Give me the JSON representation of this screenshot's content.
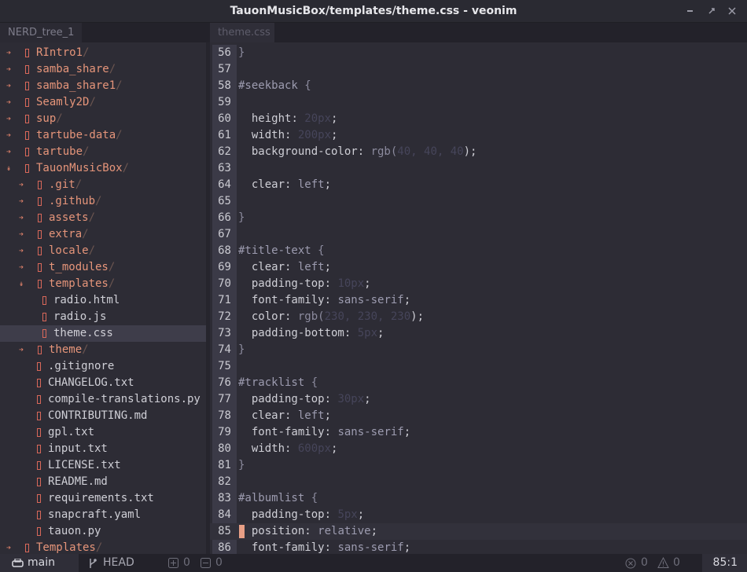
{
  "window": {
    "title": "TauonMusicBox/templates/theme.css - veonim"
  },
  "tabs": {
    "left": "NERD_tree_1",
    "right": "theme.css"
  },
  "tree": [
    {
      "indent": 0,
      "arrow": "➔",
      "name": "RIntro1",
      "slash": "/",
      "type": "dir"
    },
    {
      "indent": 0,
      "arrow": "➔",
      "name": "samba_share",
      "slash": "/",
      "type": "dir"
    },
    {
      "indent": 0,
      "arrow": "➔",
      "name": "samba_share1",
      "slash": "/",
      "type": "dir"
    },
    {
      "indent": 0,
      "arrow": "➔",
      "name": "Seamly2D",
      "slash": "/",
      "type": "dir"
    },
    {
      "indent": 0,
      "arrow": "➔",
      "name": "sup",
      "slash": "/",
      "type": "dir"
    },
    {
      "indent": 0,
      "arrow": "➔",
      "name": "tartube-data",
      "slash": "/",
      "type": "dir"
    },
    {
      "indent": 0,
      "arrow": "➔",
      "name": "tartube",
      "slash": "/",
      "type": "dir"
    },
    {
      "indent": 0,
      "arrow": "↡",
      "name": "TauonMusicBox",
      "slash": "/",
      "type": "dir"
    },
    {
      "indent": 1,
      "arrow": "➔",
      "name": ".git",
      "slash": "/",
      "type": "dir"
    },
    {
      "indent": 1,
      "arrow": "➔",
      "name": ".github",
      "slash": "/",
      "type": "dir"
    },
    {
      "indent": 1,
      "arrow": "➔",
      "name": "assets",
      "slash": "/",
      "type": "dir"
    },
    {
      "indent": 1,
      "arrow": "➔",
      "name": "extra",
      "slash": "/",
      "type": "dir"
    },
    {
      "indent": 1,
      "arrow": "➔",
      "name": "locale",
      "slash": "/",
      "type": "dir"
    },
    {
      "indent": 1,
      "arrow": "➔",
      "name": "t_modules",
      "slash": "/",
      "type": "dir"
    },
    {
      "indent": 1,
      "arrow": "↡",
      "name": "templates",
      "slash": "/",
      "type": "dir"
    },
    {
      "indent": 2,
      "arrow": "",
      "name": "radio.html",
      "slash": "",
      "type": "file"
    },
    {
      "indent": 2,
      "arrow": "",
      "name": "radio.js",
      "slash": "",
      "type": "file"
    },
    {
      "indent": 2,
      "arrow": "",
      "name": "theme.css",
      "slash": "",
      "type": "file",
      "selected": true
    },
    {
      "indent": 1,
      "arrow": "➔",
      "name": "theme",
      "slash": "/",
      "type": "dir"
    },
    {
      "indent": 1,
      "arrow": "",
      "name": ".gitignore",
      "slash": "",
      "type": "file"
    },
    {
      "indent": 1,
      "arrow": "",
      "name": "CHANGELOG.txt",
      "slash": "",
      "type": "file"
    },
    {
      "indent": 1,
      "arrow": "",
      "name": "compile-translations.py",
      "slash": "",
      "type": "file"
    },
    {
      "indent": 1,
      "arrow": "",
      "name": "CONTRIBUTING.md",
      "slash": "",
      "type": "file"
    },
    {
      "indent": 1,
      "arrow": "",
      "name": "gpl.txt",
      "slash": "",
      "type": "file"
    },
    {
      "indent": 1,
      "arrow": "",
      "name": "input.txt",
      "slash": "",
      "type": "file"
    },
    {
      "indent": 1,
      "arrow": "",
      "name": "LICENSE.txt",
      "slash": "",
      "type": "file"
    },
    {
      "indent": 1,
      "arrow": "",
      "name": "README.md",
      "slash": "",
      "type": "file"
    },
    {
      "indent": 1,
      "arrow": "",
      "name": "requirements.txt",
      "slash": "",
      "type": "file"
    },
    {
      "indent": 1,
      "arrow": "",
      "name": "snapcraft.yaml",
      "slash": "",
      "type": "file"
    },
    {
      "indent": 1,
      "arrow": "",
      "name": "tauon.py",
      "slash": "",
      "type": "file"
    },
    {
      "indent": 0,
      "arrow": "➔",
      "name": "Templates",
      "slash": "/",
      "type": "dir"
    }
  ],
  "code": [
    {
      "n": "56",
      "tokens": [
        [
          "}",
          "brace"
        ]
      ]
    },
    {
      "n": "57",
      "tokens": []
    },
    {
      "n": "58",
      "tokens": [
        [
          "#seekback",
          "sel"
        ],
        [
          " {",
          "brace"
        ]
      ]
    },
    {
      "n": "59",
      "tokens": []
    },
    {
      "n": "60",
      "tokens": [
        [
          "  height",
          "prop"
        ],
        [
          ": ",
          "punct"
        ],
        [
          "20px",
          "num"
        ],
        [
          ";",
          "punct"
        ]
      ]
    },
    {
      "n": "61",
      "tokens": [
        [
          "  width",
          "prop"
        ],
        [
          ": ",
          "punct"
        ],
        [
          "200px",
          "num"
        ],
        [
          ";",
          "punct"
        ]
      ]
    },
    {
      "n": "62",
      "tokens": [
        [
          "  background-color",
          "prop"
        ],
        [
          ": ",
          "punct"
        ],
        [
          "rgb(",
          "fn"
        ],
        [
          "40, 40, 40",
          "num"
        ],
        [
          ");",
          "punct"
        ]
      ]
    },
    {
      "n": "63",
      "tokens": []
    },
    {
      "n": "64",
      "tokens": [
        [
          "  clear",
          "prop"
        ],
        [
          ": ",
          "punct"
        ],
        [
          "left",
          "val"
        ],
        [
          ";",
          "punct"
        ]
      ]
    },
    {
      "n": "65",
      "tokens": []
    },
    {
      "n": "66",
      "tokens": [
        [
          "}",
          "brace"
        ]
      ]
    },
    {
      "n": "67",
      "tokens": []
    },
    {
      "n": "68",
      "tokens": [
        [
          "#title-text",
          "sel"
        ],
        [
          " {",
          "brace"
        ]
      ]
    },
    {
      "n": "69",
      "tokens": [
        [
          "  clear",
          "prop"
        ],
        [
          ": ",
          "punct"
        ],
        [
          "left",
          "val"
        ],
        [
          ";",
          "punct"
        ]
      ]
    },
    {
      "n": "70",
      "tokens": [
        [
          "  padding-top",
          "prop"
        ],
        [
          ": ",
          "punct"
        ],
        [
          "10px",
          "num"
        ],
        [
          ";",
          "punct"
        ]
      ]
    },
    {
      "n": "71",
      "tokens": [
        [
          "  font-family",
          "prop"
        ],
        [
          ": ",
          "punct"
        ],
        [
          "sans-serif",
          "val"
        ],
        [
          ";",
          "punct"
        ]
      ]
    },
    {
      "n": "72",
      "tokens": [
        [
          "  color",
          "prop"
        ],
        [
          ": ",
          "punct"
        ],
        [
          "rgb(",
          "fn"
        ],
        [
          "230, 230, 230",
          "num"
        ],
        [
          ");",
          "punct"
        ]
      ]
    },
    {
      "n": "73",
      "tokens": [
        [
          "  padding-bottom",
          "prop"
        ],
        [
          ": ",
          "punct"
        ],
        [
          "5px",
          "num"
        ],
        [
          ";",
          "punct"
        ]
      ]
    },
    {
      "n": "74",
      "tokens": [
        [
          "}",
          "brace"
        ]
      ]
    },
    {
      "n": "75",
      "tokens": []
    },
    {
      "n": "76",
      "tokens": [
        [
          "#tracklist",
          "sel"
        ],
        [
          " {",
          "brace"
        ]
      ]
    },
    {
      "n": "77",
      "tokens": [
        [
          "  padding-top",
          "prop"
        ],
        [
          ": ",
          "punct"
        ],
        [
          "30px",
          "num"
        ],
        [
          ";",
          "punct"
        ]
      ]
    },
    {
      "n": "78",
      "tokens": [
        [
          "  clear",
          "prop"
        ],
        [
          ": ",
          "punct"
        ],
        [
          "left",
          "val"
        ],
        [
          ";",
          "punct"
        ]
      ]
    },
    {
      "n": "79",
      "tokens": [
        [
          "  font-family",
          "prop"
        ],
        [
          ": ",
          "punct"
        ],
        [
          "sans-serif",
          "val"
        ],
        [
          ";",
          "punct"
        ]
      ]
    },
    {
      "n": "80",
      "tokens": [
        [
          "  width",
          "prop"
        ],
        [
          ": ",
          "punct"
        ],
        [
          "600px",
          "num"
        ],
        [
          ";",
          "punct"
        ]
      ]
    },
    {
      "n": "81",
      "tokens": [
        [
          "}",
          "brace"
        ]
      ]
    },
    {
      "n": "82",
      "tokens": []
    },
    {
      "n": "83",
      "tokens": [
        [
          "#albumlist",
          "sel"
        ],
        [
          " {",
          "brace"
        ]
      ]
    },
    {
      "n": "84",
      "tokens": [
        [
          "  padding-top",
          "prop"
        ],
        [
          ": ",
          "punct"
        ],
        [
          "5px",
          "num"
        ],
        [
          ";",
          "punct"
        ]
      ]
    },
    {
      "n": "85",
      "tokens": [
        [
          "  position",
          "prop"
        ],
        [
          ": ",
          "punct"
        ],
        [
          "relative",
          "val"
        ],
        [
          ";",
          "punct"
        ]
      ],
      "cursor": true
    },
    {
      "n": "86",
      "tokens": [
        [
          "  font-family",
          "prop"
        ],
        [
          ": ",
          "punct"
        ],
        [
          "sans-serif",
          "val"
        ],
        [
          ";",
          "punct"
        ]
      ]
    }
  ],
  "status": {
    "branch": "main",
    "head": "HEAD",
    "added": "0",
    "removed": "0",
    "errors": "0",
    "warnings": "0",
    "position": "85:1"
  },
  "colors": {
    "prop": "#cfcfd6",
    "punct": "#cfcfd6",
    "val": "#9d9cb0",
    "num": "#46455a",
    "sel": "#9d9cb0",
    "brace": "#8c8b9e",
    "fn": "#8c8b9e"
  }
}
